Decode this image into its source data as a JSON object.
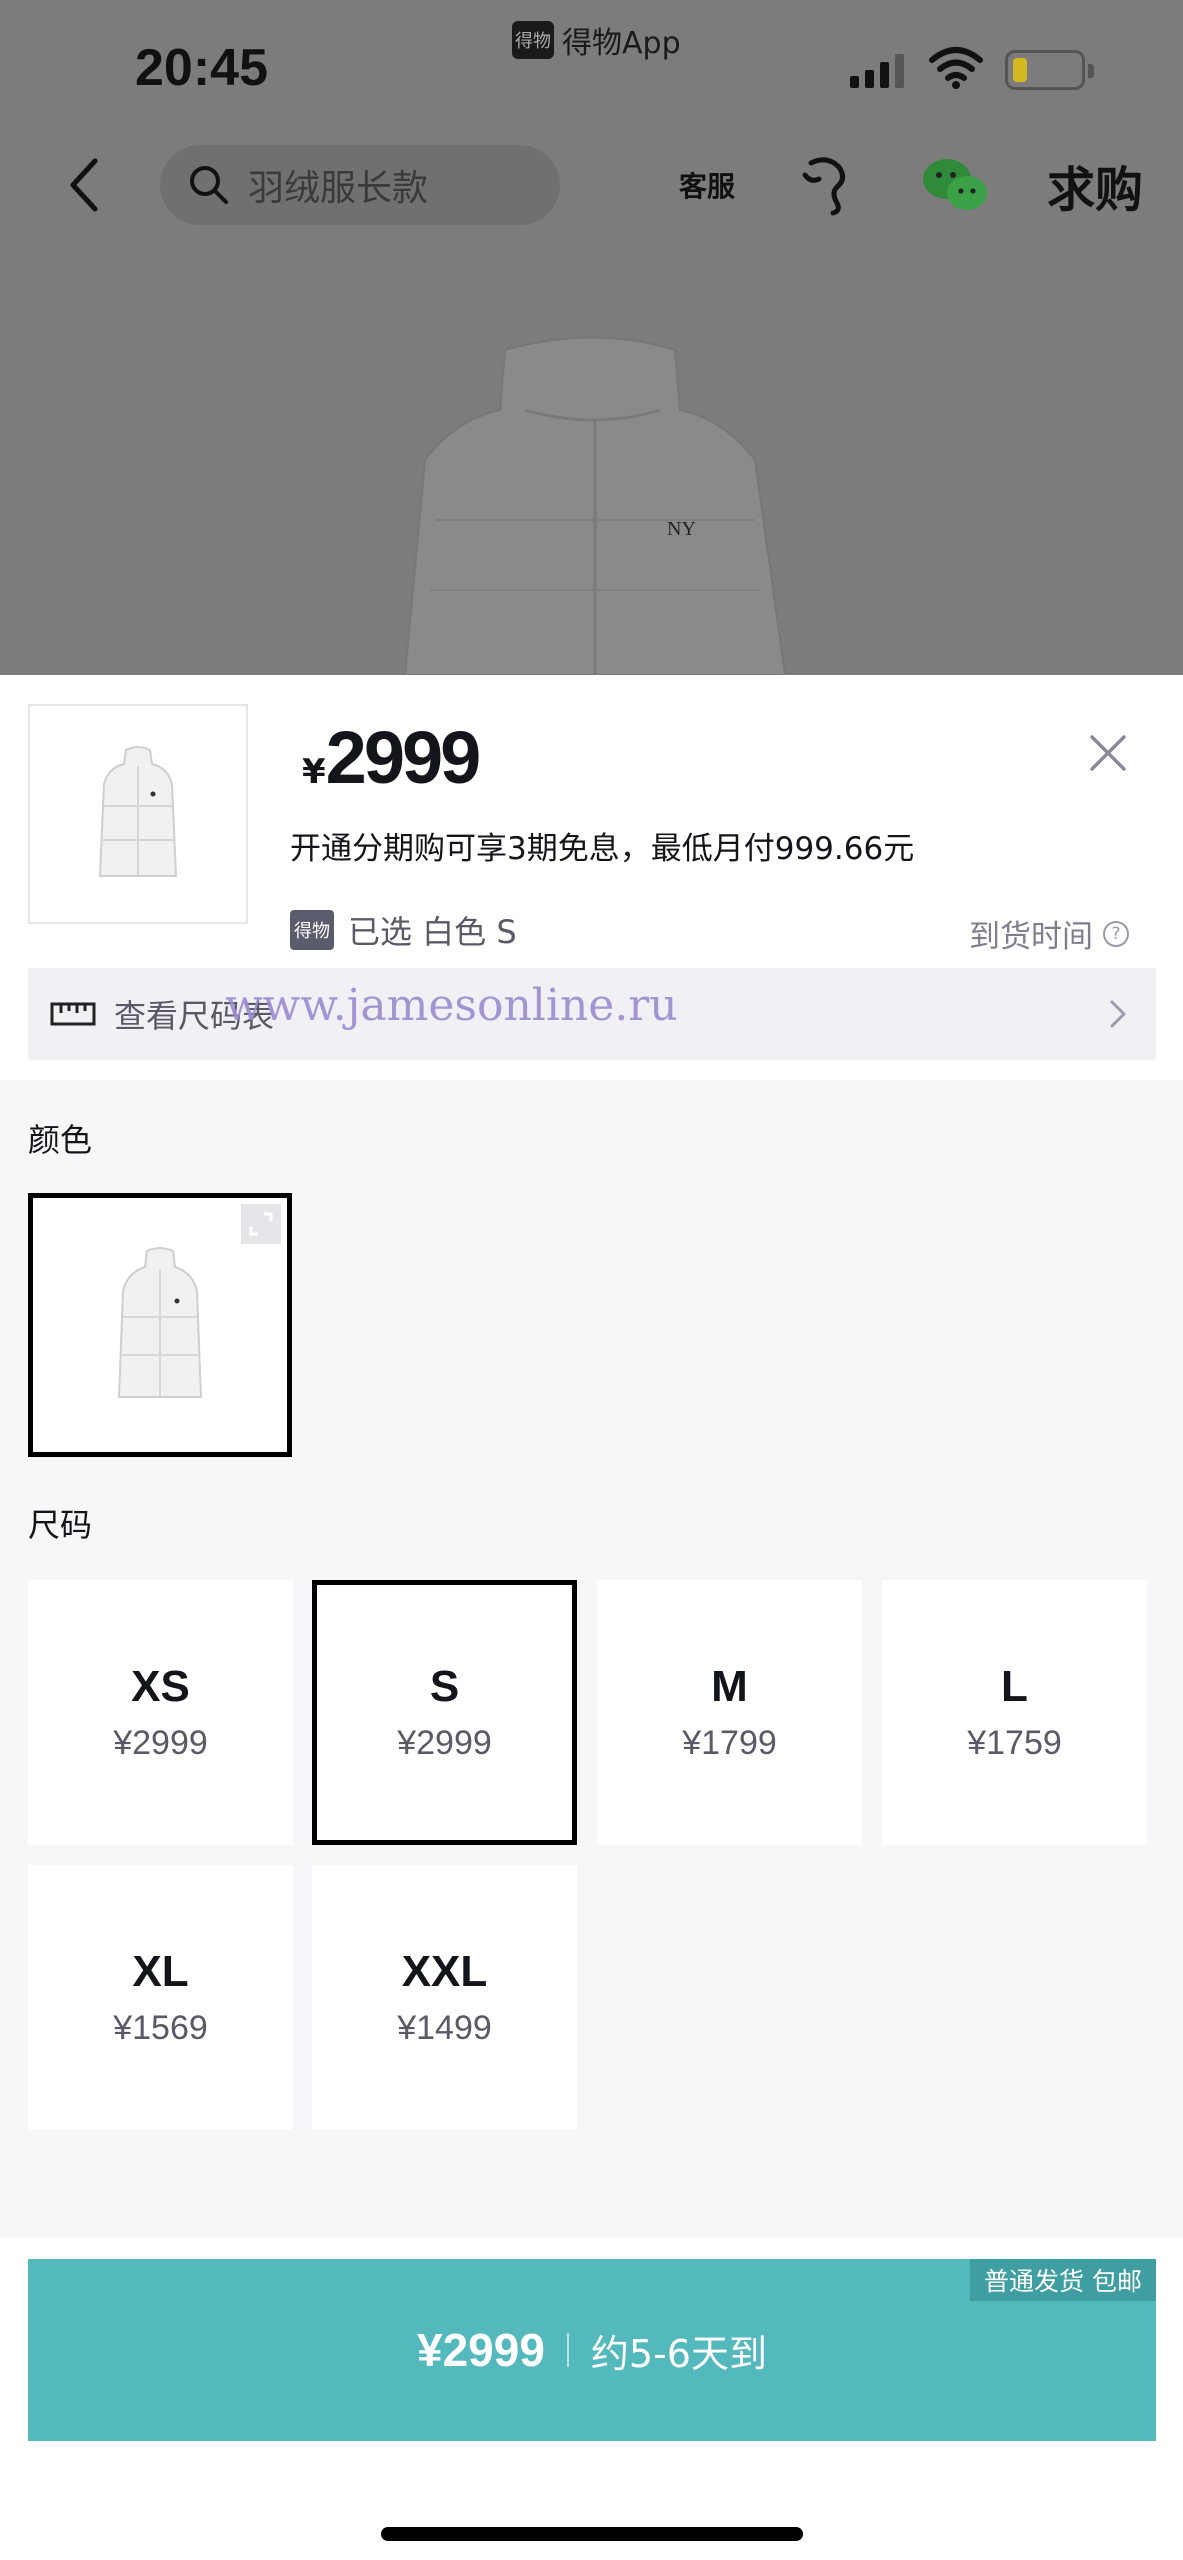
{
  "status_bar": {
    "time": "20:45",
    "app_name": "得物App",
    "app_logo_text": "得物"
  },
  "nav": {
    "search_placeholder": "羽绒服长款",
    "customer_service_label": "客服",
    "request_purchase_label": "求购"
  },
  "product": {
    "currency": "¥",
    "price": "2999",
    "installment_text": "开通分期购可享3期免息，最低月付999.66元",
    "selected_tag": "得物",
    "selected_text": "已选 白色 S",
    "arrival_label": "到货时间",
    "size_chart_label": "查看尺码表",
    "watermark": "www.jamesonline.ru"
  },
  "color_section": {
    "label": "颜色"
  },
  "size_section": {
    "label": "尺码",
    "sizes": [
      {
        "size": "XS",
        "price": "¥2999"
      },
      {
        "size": "S",
        "price": "¥2999",
        "selected": true
      },
      {
        "size": "M",
        "price": "¥1799"
      },
      {
        "size": "L",
        "price": "¥1759"
      },
      {
        "size": "XL",
        "price": "¥1569"
      },
      {
        "size": "XXL",
        "price": "¥1499"
      }
    ]
  },
  "footer": {
    "buy_price": "¥2999",
    "eta": "约5-6天到",
    "shipping_tag": "普通发货 包邮"
  },
  "colors": {
    "accent": "#53b9bc",
    "accent_dark": "#3e9ea2",
    "battery_level": "#d4b820"
  },
  "battery_level_fraction": 0.15
}
